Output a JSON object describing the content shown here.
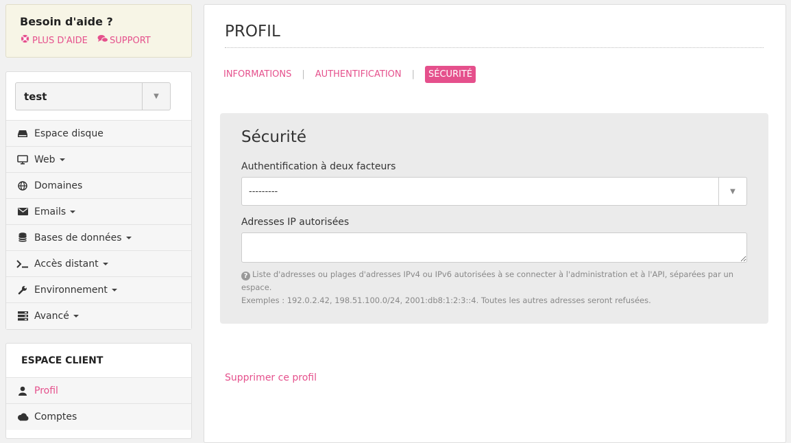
{
  "help": {
    "title": "Besoin d'aide ?",
    "more_help": "PLUS D'AIDE",
    "support": "SUPPORT"
  },
  "sidebar": {
    "account_select": "test",
    "items": [
      {
        "label": "Espace disque",
        "icon": "hdd-icon"
      },
      {
        "label": "Web",
        "icon": "monitor-icon"
      },
      {
        "label": "Domaines",
        "icon": "globe-icon"
      },
      {
        "label": "Emails",
        "icon": "envelope-icon"
      },
      {
        "label": "Bases de données",
        "icon": "database-icon"
      },
      {
        "label": "Accès distant",
        "icon": "terminal-icon"
      },
      {
        "label": "Environnement",
        "icon": "wrench-icon"
      },
      {
        "label": "Avancé",
        "icon": "server-icon"
      }
    ]
  },
  "client": {
    "title": "ESPACE CLIENT",
    "items": [
      {
        "label": "Profil",
        "icon": "user-icon"
      },
      {
        "label": "Comptes",
        "icon": "cloud-icon"
      }
    ]
  },
  "main": {
    "title": "PROFIL",
    "tabs": [
      "INFORMATIONS",
      "AUTHENTIFICATION",
      "SÉCURITÉ"
    ],
    "active_tab": "SÉCURITÉ",
    "section_title": "Sécurité",
    "two_factor_label": "Authentification à deux facteurs",
    "two_factor_value": "---------",
    "ip_label": "Adresses IP autorisées",
    "ip_value": "",
    "ip_help_1": "Liste d'adresses ou plages d'adresses IPv4 ou IPv6 autorisées à se connecter à l'administration et à l'API, séparées par un espace.",
    "ip_help_2": "Exemples : 192.0.2.42, 198.51.100.0/24, 2001:db8:1:2:3::4. Toutes les autres adresses seront refusées.",
    "delete_link": "Supprimer ce profil"
  },
  "colors": {
    "accent": "#e5508c",
    "help_bg": "#f7f5e6",
    "card_bg": "#ebebeb"
  }
}
